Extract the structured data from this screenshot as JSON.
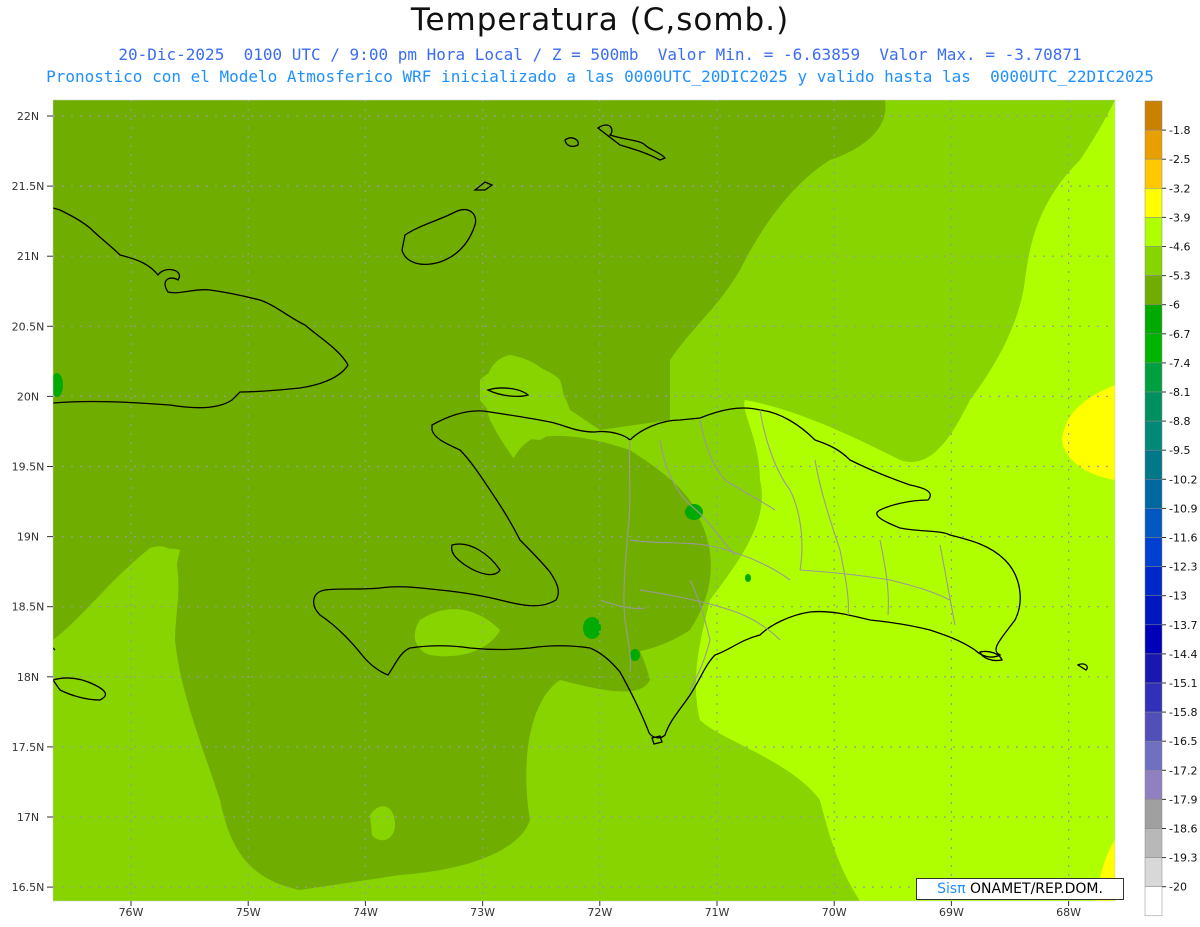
{
  "title": "Temperatura (C,somb.)",
  "subtitle_line1": "20-Dic-2025  0100 UTC / 9:00 pm Hora Local / Z = 500mb  Valor Min. = -6.63859  Valor Max. = -3.70871",
  "subtitle_line2": "Pronostico con el Modelo Atmosferico WRF inicializado a las 0000UTC_20DIC2025 y valido hasta las  0000UTC_22DIC2025",
  "badge": {
    "brand": "Sisπ",
    "text": " ONAMET/REP.DOM."
  },
  "colors": {
    "text_blue": "#3a6cf4",
    "shade_-5.3": "#6fae00",
    "shade_-4.6": "#88d400",
    "shade_-3.9": "#b0ff00",
    "shade_-3.2": "#ffff00",
    "shade_-6.0": "#5a9600"
  },
  "lat_labels": [
    "22N",
    "21.5N",
    "21N",
    "20.5N",
    "20N",
    "19.5N",
    "19N",
    "18.5N",
    "18N",
    "17.5N",
    "17N",
    "16.5N"
  ],
  "lon_labels": [
    "76W",
    "75W",
    "74W",
    "73W",
    "72W",
    "71W",
    "70W",
    "69W",
    "68W"
  ],
  "legend": [
    {
      "label": "-1.8",
      "color": "#cc8000"
    },
    {
      "label": "-2.5",
      "color": "#e8a000"
    },
    {
      "label": "-3.2",
      "color": "#ffc800"
    },
    {
      "label": "-3.9",
      "color": "#ffff00"
    },
    {
      "label": "-4.6",
      "color": "#b0ff00"
    },
    {
      "label": "-5.3",
      "color": "#88d400"
    },
    {
      "label": "-6",
      "color": "#6fae00"
    },
    {
      "label": "-6.7",
      "color": "#00aa00"
    },
    {
      "label": "-7.4",
      "color": "#00b400"
    },
    {
      "label": "-8.1",
      "color": "#00a040"
    },
    {
      "label": "-8.8",
      "color": "#009060"
    },
    {
      "label": "-9.5",
      "color": "#008878"
    },
    {
      "label": "-10.2",
      "color": "#007888"
    },
    {
      "label": "-10.9",
      "color": "#0068a0"
    },
    {
      "label": "-11.6",
      "color": "#0058c0"
    },
    {
      "label": "-12.3",
      "color": "#0040d0"
    },
    {
      "label": "-13",
      "color": "#0028c8"
    },
    {
      "label": "-13.7",
      "color": "#0018c0"
    },
    {
      "label": "-14.4",
      "color": "#0000b8"
    },
    {
      "label": "-15.1",
      "color": "#1818b0"
    },
    {
      "label": "-15.8",
      "color": "#3030b8"
    },
    {
      "label": "-16.5",
      "color": "#5050b8"
    },
    {
      "label": "-17.2",
      "color": "#7070c0"
    },
    {
      "label": "-17.9",
      "color": "#9080c0"
    },
    {
      "label": "-18.6",
      "color": "#a0a0a0"
    },
    {
      "label": "-19.3",
      "color": "#b8b8b8"
    },
    {
      "label": "-20",
      "color": "#d8d8d8"
    },
    {
      "label": "",
      "color": "#ffffff"
    }
  ]
}
